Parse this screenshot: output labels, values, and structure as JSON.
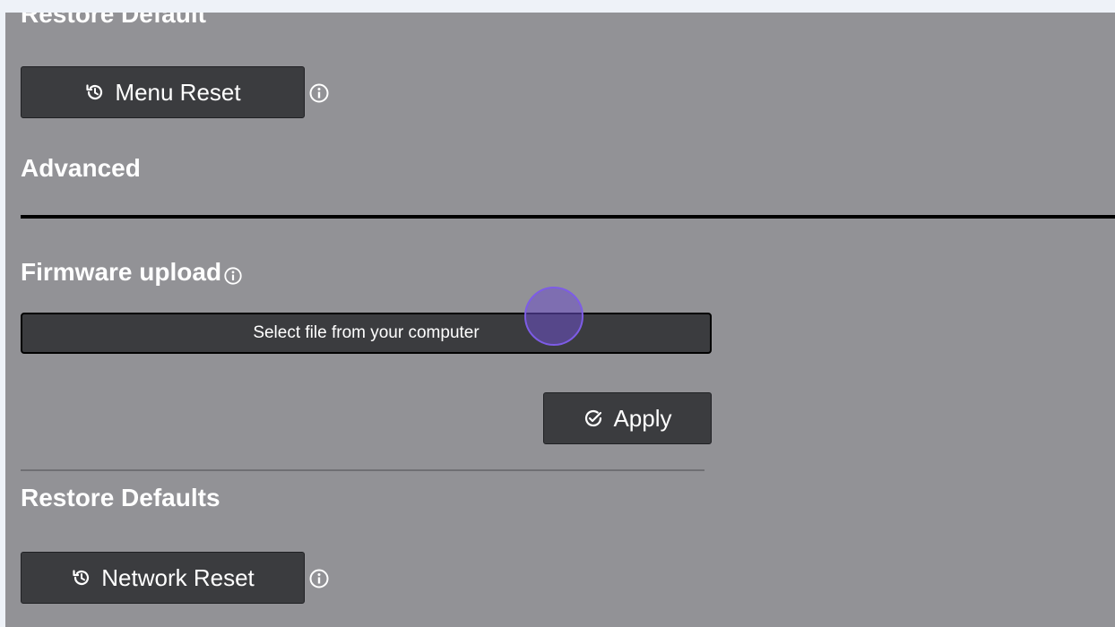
{
  "sections": {
    "restore_default_cut": "Restore Default",
    "advanced": "Advanced",
    "firmware_upload": "Firmware upload",
    "restore_defaults": "Restore Defaults"
  },
  "buttons": {
    "menu_reset": "Menu Reset",
    "apply": "Apply",
    "network_reset": "Network Reset"
  },
  "file_picker": {
    "label": "Select file from your computer"
  },
  "colors": {
    "page_bg": "#eef2f8",
    "panel_bg": "#929296",
    "button_bg": "#3b3c3f",
    "cursor_highlight": "#7d5ce6"
  },
  "icons": {
    "reset": "history-icon",
    "apply": "check-circle-icon",
    "info": "info-icon"
  }
}
